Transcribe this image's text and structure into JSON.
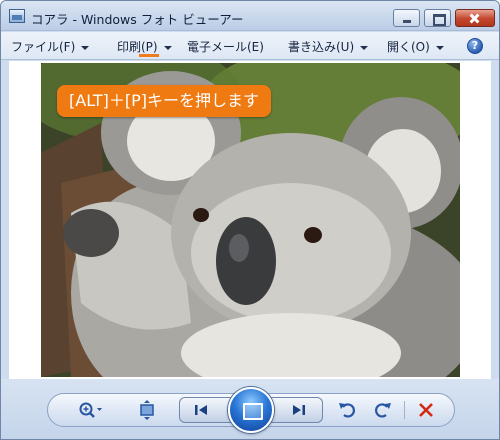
{
  "window": {
    "title": "コアラ - Windows フォト ビューアー"
  },
  "menu": {
    "file": "ファイル(F)",
    "print": "印刷(P)",
    "email": "電子メール(E)",
    "burn": "書き込み(U)",
    "open": "開く(O)"
  },
  "callout": {
    "text": "[ALT]＋[P]キーを押します"
  },
  "icons": {
    "help": "?",
    "zoom": "zoom-icon",
    "fit": "fit-to-window-icon",
    "previous": "previous-icon",
    "slideshow": "slideshow-icon",
    "next": "next-icon",
    "rotate_left": "rotate-counterclockwise-icon",
    "rotate_right": "rotate-clockwise-icon",
    "delete": "delete-icon"
  },
  "colors": {
    "accent": "#f07a12",
    "delete": "#d22a12"
  }
}
